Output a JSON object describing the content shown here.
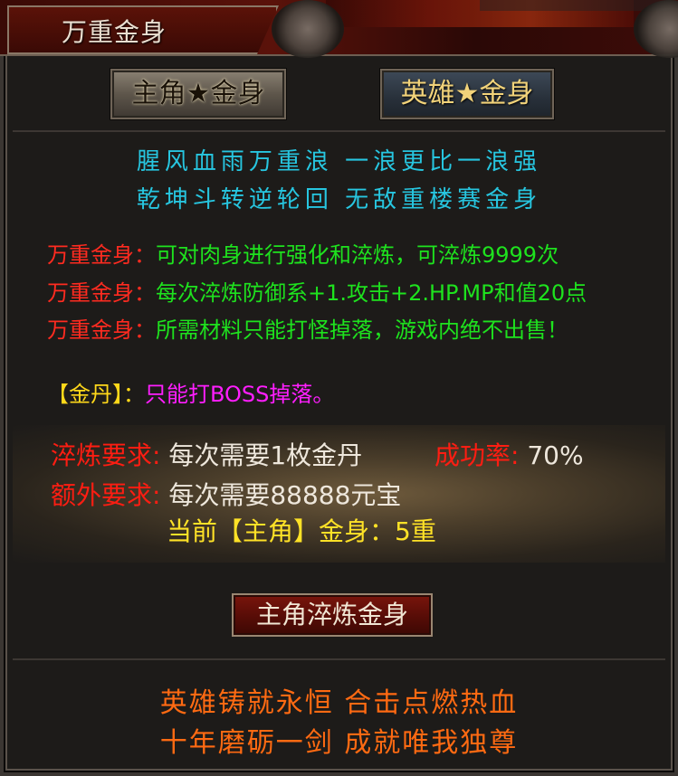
{
  "window": {
    "title": "万重金身"
  },
  "tabs": [
    {
      "label": "主角★金身",
      "active": true
    },
    {
      "label": "英雄★金身",
      "active": false
    }
  ],
  "poem": {
    "line1": "腥风血雨万重浪  一浪更比一浪强",
    "line2": "乾坤斗转逆轮回  无敌重楼赛金身"
  },
  "info": [
    {
      "label": "万重金身：",
      "text": "可对肉身进行强化和淬炼，可淬炼9999次"
    },
    {
      "label": "万重金身：",
      "text": "每次淬炼防御系+1.攻击+2.HP.MP和值20点"
    },
    {
      "label": "万重金身：",
      "text": "所需材料只能打怪掉落，游戏内绝不出售！"
    }
  ],
  "jindan": {
    "label": "【金丹】：",
    "text": "只能打BOSS掉落。"
  },
  "requirements": {
    "refine_label": "淬炼要求:",
    "refine_value": "每次需要1枚金丹",
    "rate_label": "成功率:",
    "rate_value": "70%",
    "extra_label": "额外要求:",
    "extra_value": "每次需要88888元宝",
    "current": "当前【主角】金身：5重"
  },
  "action": {
    "label": "主角淬炼金身"
  },
  "footer": {
    "line1": "英雄铸就永恒  合击点燃热血",
    "line2": "十年磨砺一剑  成就唯我独尊"
  },
  "colors": {
    "poem": "#27c6e0",
    "info_label": "#ff2b20",
    "info_text": "#1ee21e",
    "jindan_label": "#ffd81a",
    "jindan_text": "#ff1eff",
    "current": "#ffe227",
    "footer": "#ff6a12"
  }
}
